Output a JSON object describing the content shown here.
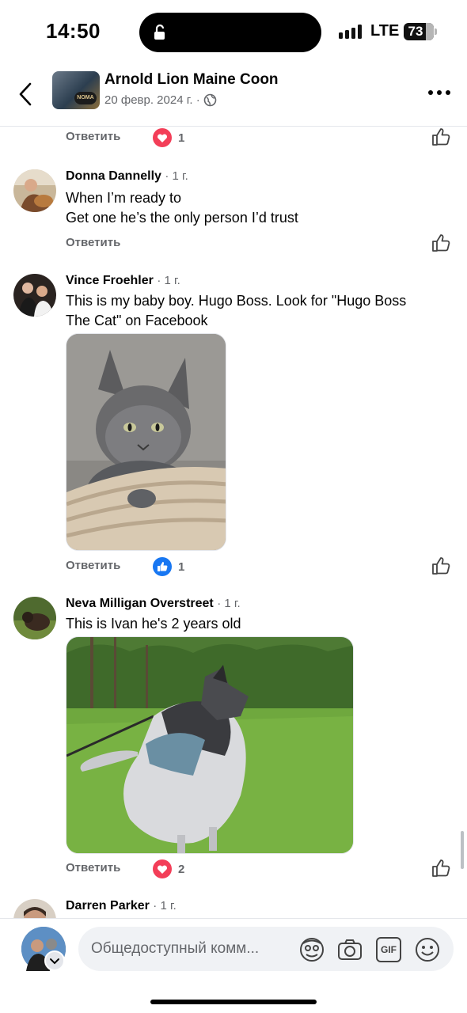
{
  "status_bar": {
    "time": "14:50",
    "network": "LTE",
    "battery": "73"
  },
  "header": {
    "title": "Arnold Lion Maine Coon",
    "date": "20 февр. 2024 г. ·",
    "avatar_badge": "NOMA"
  },
  "reply_label": "Ответить",
  "top_row": {
    "reaction": "love",
    "count": "1"
  },
  "comments": [
    {
      "name": "Donna Dannelly",
      "time": "· 1 г.",
      "text_lines": [
        "When I’m ready to",
        "Get one he’s the only person I’d trust"
      ]
    },
    {
      "name": "Vince Froehler",
      "time": "· 1 г.",
      "text_lines": [
        "This is my baby boy. Hugo Boss. Look for \"Hugo Boss",
        "The Cat\" on Facebook"
      ],
      "reaction": "like",
      "count": "1"
    },
    {
      "name": "Neva Milligan Overstreet",
      "time": "· 1 г.",
      "text_lines": [
        "This is Ivan he's 2 years old"
      ],
      "reaction": "love",
      "count": "2"
    },
    {
      "name": "Darren Parker",
      "time": "· 1 г."
    }
  ],
  "comment_bar": {
    "placeholder": "Общедоступный комм...",
    "gif_label": "GIF"
  },
  "colors": {
    "accent": "#1877f2",
    "love": "#f33e58",
    "secondary_text": "#65676b"
  },
  "icons": [
    "back-arrow-icon",
    "globe-icon",
    "more-icon",
    "heart-reaction-icon",
    "like-reaction-icon",
    "thumbs-up-outline-icon",
    "avatar-frame-icon",
    "camera-icon",
    "gif-icon",
    "emoji-icon",
    "chevron-down-icon"
  ]
}
